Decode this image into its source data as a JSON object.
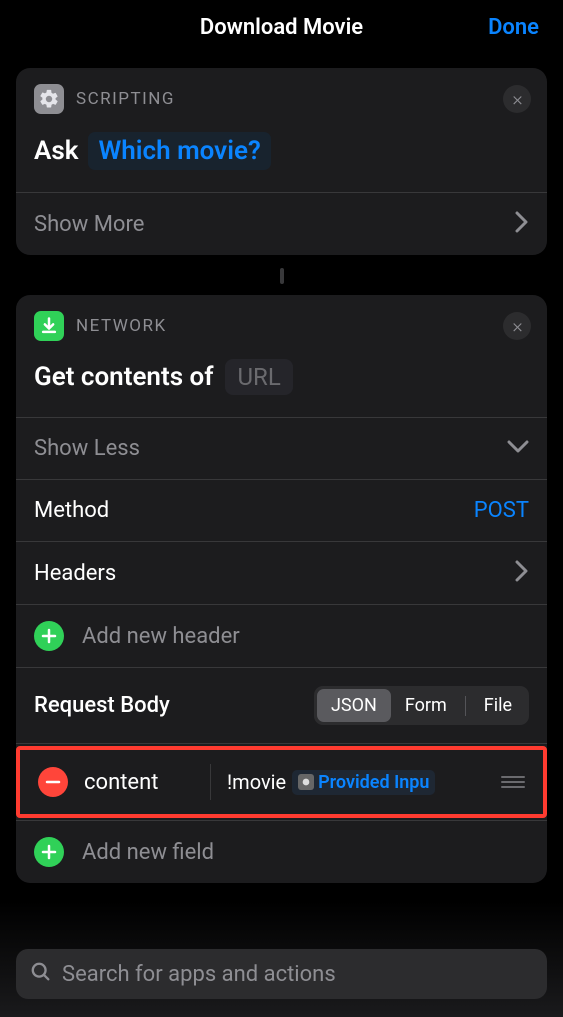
{
  "header": {
    "title": "Download Movie",
    "done": "Done"
  },
  "scripting": {
    "category": "SCRIPTING",
    "ask_label": "Ask",
    "prompt": "Which movie?",
    "show_more": "Show More"
  },
  "network": {
    "category": "NETWORK",
    "get_label": "Get contents of",
    "url_placeholder": "URL",
    "show_less": "Show Less",
    "method_label": "Method",
    "method_value": "POST",
    "headers_label": "Headers",
    "add_header": "Add new header",
    "body_label": "Request Body",
    "body_types": {
      "json": "JSON",
      "form": "Form",
      "file": "File"
    },
    "body_selected": "JSON",
    "field": {
      "key": "content",
      "prefix": "!movie",
      "token": "Provided Inpu"
    },
    "add_field": "Add new field"
  },
  "search": {
    "placeholder": "Search for apps and actions"
  }
}
